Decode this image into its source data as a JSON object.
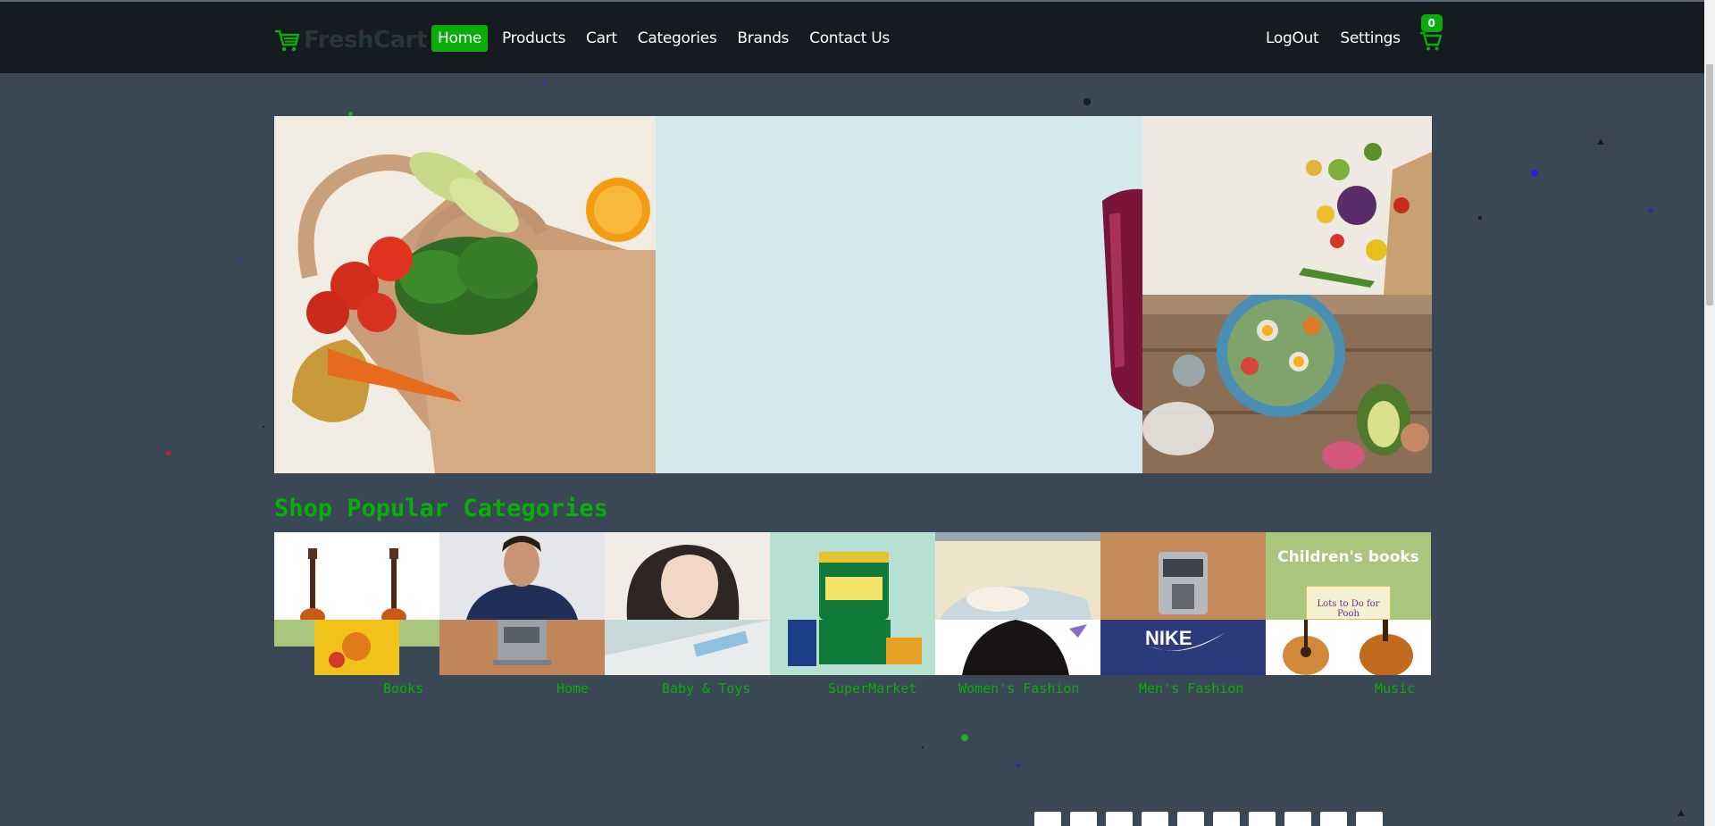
{
  "brand": {
    "name": "FreshCart",
    "logo_icon": "shopping-cart-icon"
  },
  "nav": {
    "links": [
      {
        "label": "Home",
        "active": true
      },
      {
        "label": "Products",
        "active": false
      },
      {
        "label": "Cart",
        "active": false
      },
      {
        "label": "Categories",
        "active": false
      },
      {
        "label": "Brands",
        "active": false
      },
      {
        "label": "Contact Us",
        "active": false
      }
    ],
    "right": {
      "logout": "LogOut",
      "settings": "Settings",
      "cart_count": "0",
      "cart_icon": "shopping-cart-icon"
    }
  },
  "colors": {
    "accent": "#0aad0a",
    "navbar": "#161b22",
    "page_bg": "#3a4754"
  },
  "section": {
    "title": "Shop Popular Categories"
  },
  "categories": [
    {
      "label": "Books"
    },
    {
      "label": "Home"
    },
    {
      "label": "Baby & Toys"
    },
    {
      "label": "SuperMarket"
    },
    {
      "label": "Women's Fashion"
    },
    {
      "label": "Men's Fashion"
    },
    {
      "label": "Music"
    }
  ],
  "tile_text": {
    "childrens_books": "Children's books",
    "book_cover": "Lots to Do for Pooh",
    "nike": "NIKE"
  }
}
